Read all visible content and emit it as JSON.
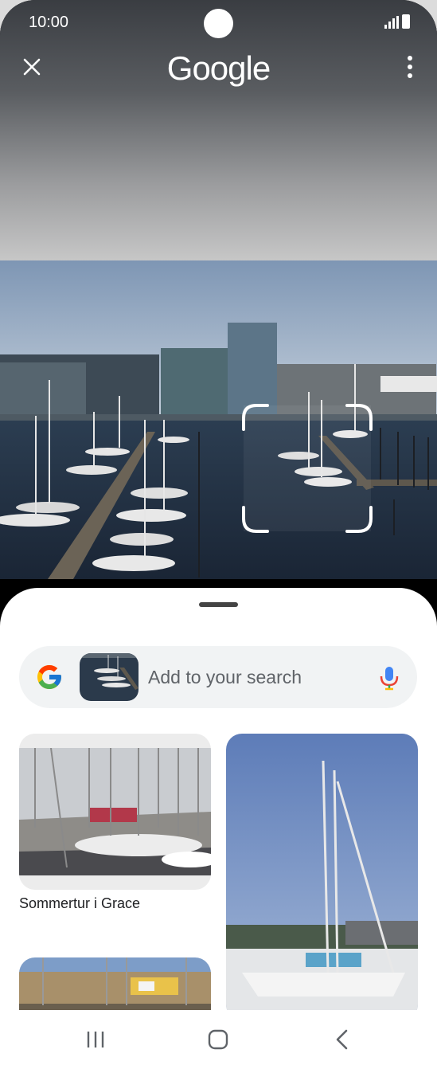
{
  "status_bar": {
    "time": "10:00"
  },
  "header": {
    "logo_text": "Google",
    "close_icon": "close-icon",
    "more_icon": "more-vert-icon"
  },
  "search": {
    "placeholder": "Add to your search",
    "google_icon": "google-g-icon",
    "mic_icon": "mic-icon"
  },
  "results": [
    {
      "caption": "Sommertur i Grace"
    }
  ],
  "nav": {
    "recents": "recents-icon",
    "home": "home-icon",
    "back": "back-icon"
  },
  "colors": {
    "google_blue": "#4285F4",
    "google_red": "#EA4335",
    "google_yellow": "#FBBC05",
    "google_green": "#34A853"
  }
}
